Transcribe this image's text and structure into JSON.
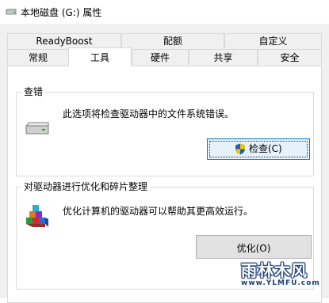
{
  "window": {
    "title": "本地磁盘 (G:) 属性",
    "icon": "drive-icon"
  },
  "tabs": {
    "row1": [
      {
        "label": "ReadyBoost"
      },
      {
        "label": "配额"
      },
      {
        "label": "自定义"
      }
    ],
    "row2": [
      {
        "label": "常规"
      },
      {
        "label": "工具",
        "active": true
      },
      {
        "label": "硬件"
      },
      {
        "label": "共享"
      },
      {
        "label": "安全"
      }
    ]
  },
  "check_group": {
    "title": "查错",
    "description": "此选项将检查驱动器中的文件系统错误。",
    "button_label": "检查(C)",
    "button_icon": "uac-shield-icon",
    "icon": "drive-icon"
  },
  "optimize_group": {
    "title": "对驱动器进行优化和碎片整理",
    "description": "优化计算机的驱动器可以帮助其更高效运行。",
    "button_label": "优化(O)",
    "icon": "defrag-icon"
  },
  "watermark": {
    "brand": "雨林木风",
    "url": "www.YLMFU.com"
  },
  "colors": {
    "accent": "#0078d7",
    "window_bg": "#f0f0f0",
    "panel_bg": "#ffffff",
    "watermark_blue": "#1a3f73"
  }
}
